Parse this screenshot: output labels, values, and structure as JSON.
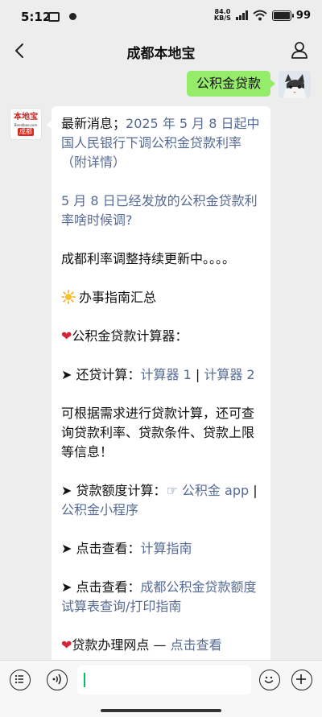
{
  "status_bar": {
    "time": "5:12",
    "net_speed_value": "84.0",
    "net_speed_unit": "KB/S",
    "battery": "99"
  },
  "nav": {
    "title": "成都本地宝"
  },
  "user_message": {
    "text": "公积金贷款"
  },
  "bot_avatar": {
    "brand_text": "本地宝",
    "url_text": "Bendibao.com",
    "city_tag": "成都"
  },
  "bot_message": {
    "latest_label": "最新消息；",
    "latest_link": "2025 年 5 月 8 日起中国人民银行下调公积金贷款利率（附详情）",
    "link2": "5 月 8 日已经发放的公积金贷款利率啥时候调?",
    "updating": "成都利率调整持续更新中。。。。",
    "guide_title": "办事指南汇总",
    "calc_title": "公积金贷款计算器：",
    "repay_label": "➤ 还贷计算：",
    "calc1": "计算器 1",
    "sep1": " | ",
    "calc2": "计算器 2",
    "calc_desc": "可根据需求进行贷款计算，还可查询贷款利率、贷款条件、贷款上限等信息！",
    "quota_label": "➤ 贷款额度计算：",
    "quota_app": "☞ 公积金 app",
    "sep2": " | ",
    "quota_mini": "公积金小程序",
    "view_label_1": "➤ 点击查看：",
    "view_link_1": "计算指南",
    "view_label_2": "➤ 点击查看：",
    "view_link_2": "成都公积金贷款额度试算表查询/打印指南",
    "outlets_label": "贷款办理网点",
    "outlets_link": "点击查看"
  }
}
